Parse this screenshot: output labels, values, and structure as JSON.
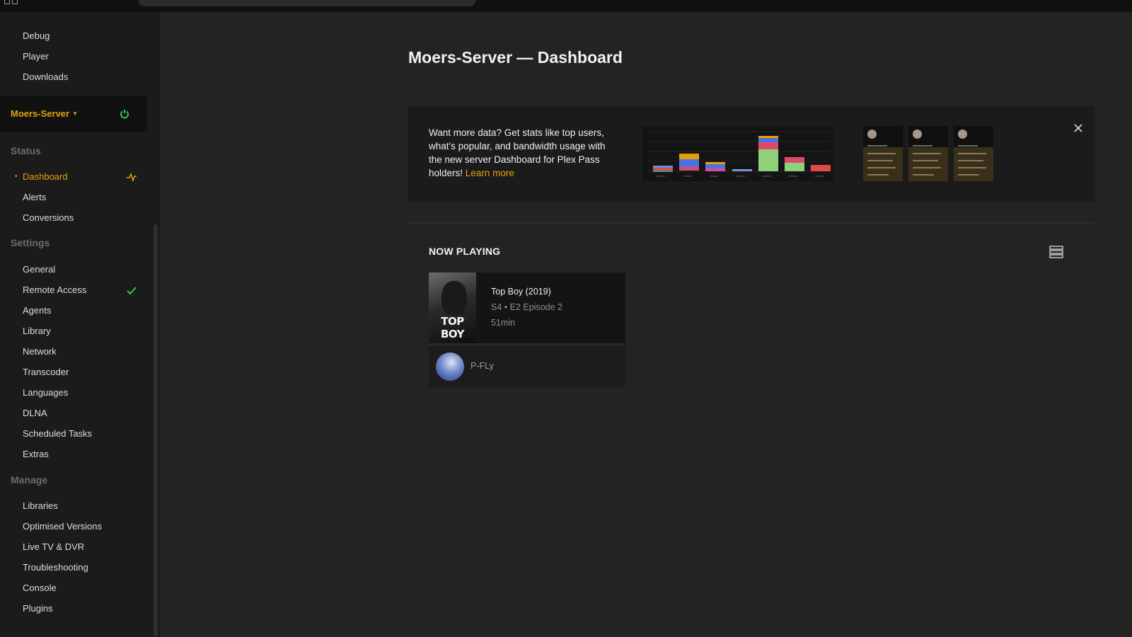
{
  "sidebar": {
    "top_items": [
      {
        "label": "Debug"
      },
      {
        "label": "Player"
      },
      {
        "label": "Downloads"
      }
    ],
    "server": {
      "name": "Moers-Server",
      "status_icon": "power-icon",
      "status_color": "#2ecc40"
    },
    "sections": {
      "status": {
        "heading": "Status",
        "items": [
          {
            "label": "Dashboard",
            "active": true,
            "icon": "activity-icon"
          },
          {
            "label": "Alerts"
          },
          {
            "label": "Conversions"
          }
        ]
      },
      "settings": {
        "heading": "Settings",
        "items": [
          {
            "label": "General"
          },
          {
            "label": "Remote Access",
            "icon": "check-icon"
          },
          {
            "label": "Agents"
          },
          {
            "label": "Library"
          },
          {
            "label": "Network"
          },
          {
            "label": "Transcoder"
          },
          {
            "label": "Languages"
          },
          {
            "label": "DLNA"
          },
          {
            "label": "Scheduled Tasks"
          },
          {
            "label": "Extras"
          }
        ]
      },
      "manage": {
        "heading": "Manage",
        "items": [
          {
            "label": "Libraries"
          },
          {
            "label": "Optimised Versions"
          },
          {
            "label": "Live TV & DVR"
          },
          {
            "label": "Troubleshooting"
          },
          {
            "label": "Console"
          },
          {
            "label": "Plugins"
          }
        ]
      }
    }
  },
  "main": {
    "title": "Moers-Server — Dashboard",
    "promo": {
      "text": "Want more data? Get stats like top users, what's popular, and bandwidth usage with the new server Dashboard for Plex Pass holders!",
      "link_label": "Learn more",
      "close_icon": "close-icon"
    },
    "now_playing": {
      "heading": "NOW PLAYING",
      "view_icon": "list-view-icon",
      "items": [
        {
          "poster_text": "TOP BOY",
          "title": "Top Boy (2019)",
          "subtitle": "S4 • E2 Episode 2",
          "duration": "51min",
          "user": "P-FLy"
        }
      ]
    }
  },
  "colors": {
    "accent": "#e5a00d",
    "background": "#232323",
    "sidebar": "#1b1b1b"
  }
}
